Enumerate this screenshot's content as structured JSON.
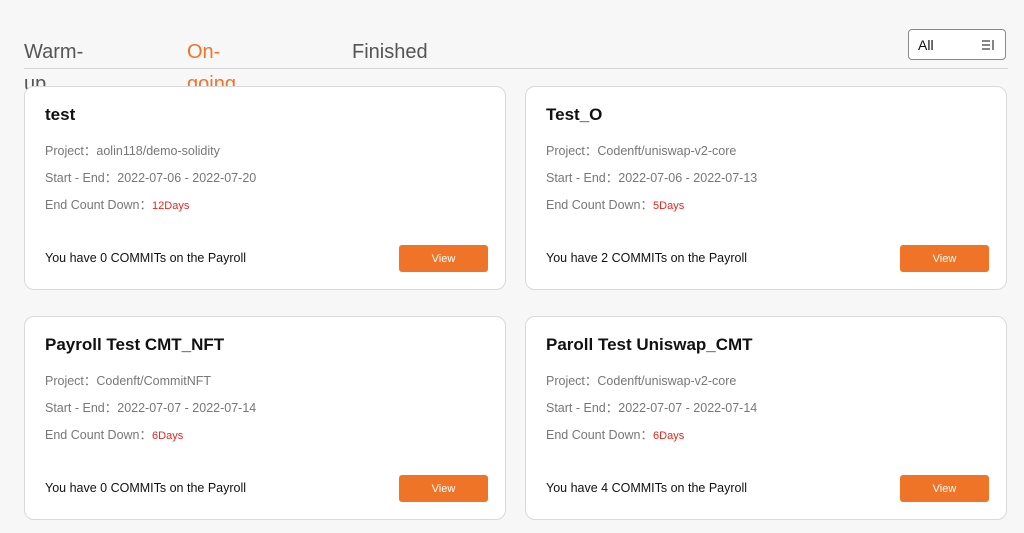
{
  "tabs": [
    {
      "label": "Warm-up",
      "active": false
    },
    {
      "label": "On-going",
      "active": true
    },
    {
      "label": "Finished",
      "active": false
    }
  ],
  "filter": {
    "value": "All",
    "icon": "sort-lines-icon"
  },
  "colors": {
    "accent": "#f07427",
    "countdown": "#e5261f"
  },
  "cards": [
    {
      "title": "test",
      "project_label": "Project：",
      "project": "aolin118/demo-solidity",
      "dates_label": "Start - End：",
      "dates": "2022-07-06 - 2022-07-20",
      "countdown_label": "End Count Down：",
      "countdown": "12Days",
      "commits": "You have 0 COMMITs on the Payroll",
      "button": "View"
    },
    {
      "title": "Test_O",
      "project_label": "Project：",
      "project": "Codenft/uniswap-v2-core",
      "dates_label": "Start - End：",
      "dates": "2022-07-06 - 2022-07-13",
      "countdown_label": "End Count Down：",
      "countdown": "5Days",
      "commits": "You have 2 COMMITs on the Payroll",
      "button": "View"
    },
    {
      "title": "Payroll Test CMT_NFT",
      "project_label": "Project：",
      "project": "Codenft/CommitNFT",
      "dates_label": "Start - End：",
      "dates": "2022-07-07 - 2022-07-14",
      "countdown_label": "End Count Down：",
      "countdown": "6Days",
      "commits": "You have 0 COMMITs on the Payroll",
      "button": "View"
    },
    {
      "title": "Paroll Test Uniswap_CMT",
      "project_label": "Project：",
      "project": "Codenft/uniswap-v2-core",
      "dates_label": "Start - End：",
      "dates": "2022-07-07 - 2022-07-14",
      "countdown_label": "End Count Down：",
      "countdown": "6Days",
      "commits": "You have 4 COMMITs on the Payroll",
      "button": "View"
    }
  ]
}
